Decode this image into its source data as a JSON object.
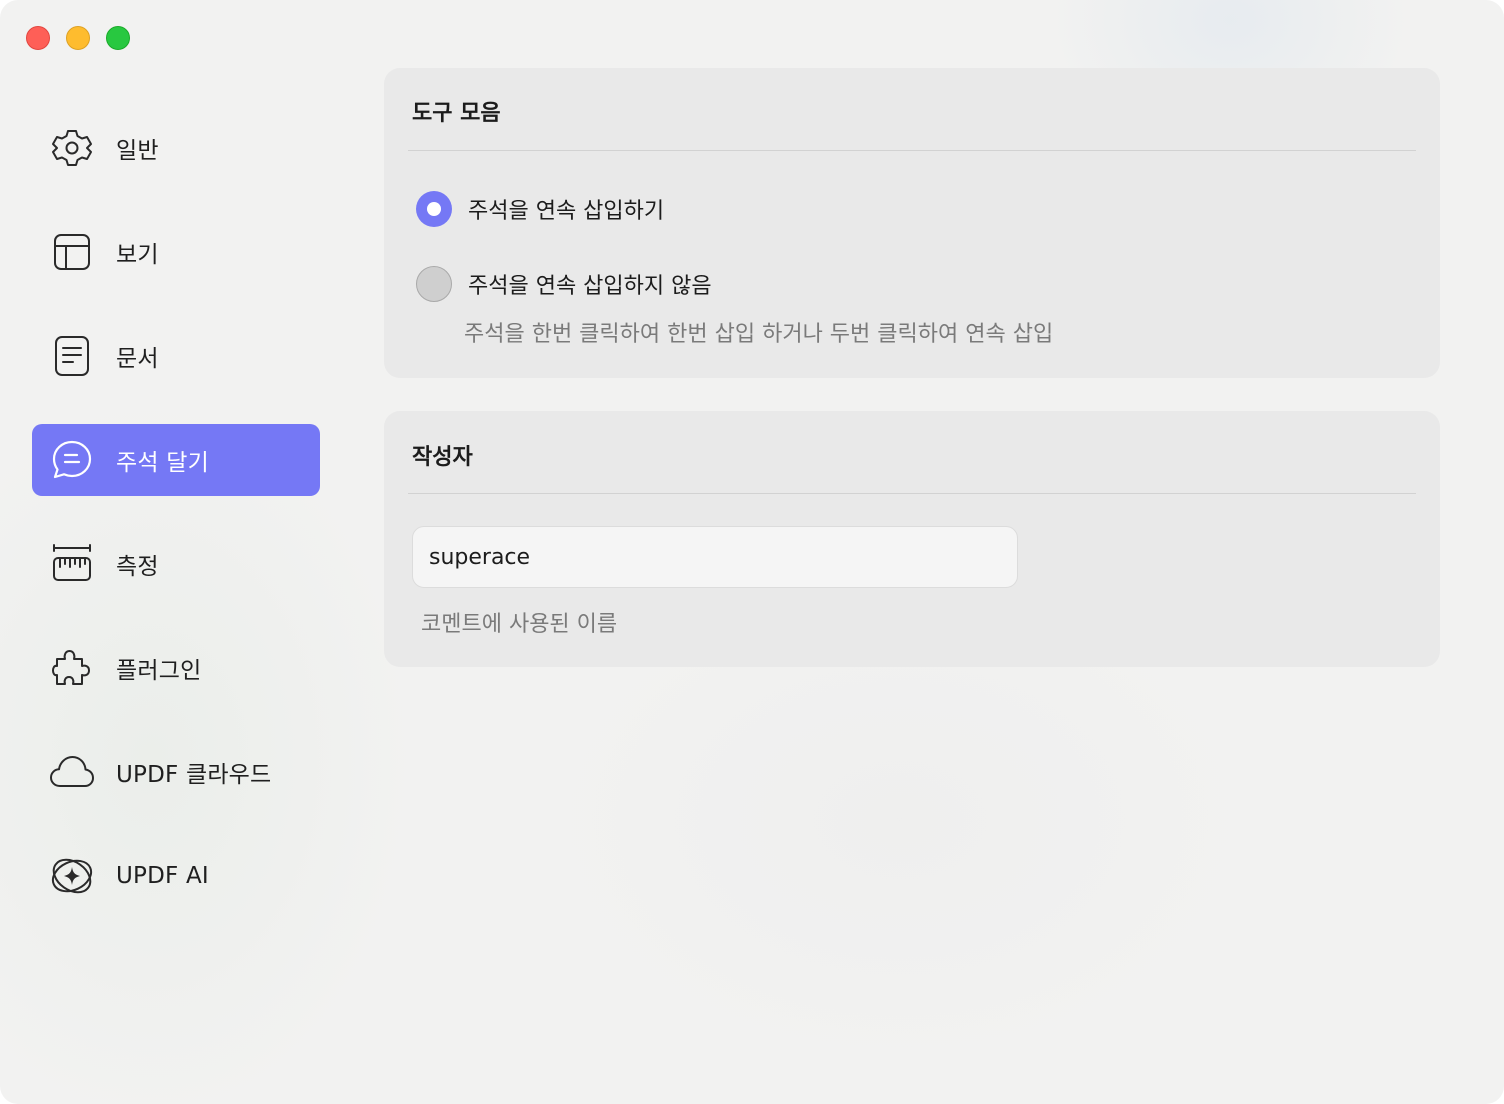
{
  "window": {
    "controls": [
      "close",
      "minimize",
      "maximize"
    ]
  },
  "sidebar": {
    "accent": "#7578f5",
    "items": [
      {
        "label": "일반",
        "icon": "gear-icon"
      },
      {
        "label": "보기",
        "icon": "layout-icon"
      },
      {
        "label": "문서",
        "icon": "document-icon"
      },
      {
        "label": "주석 달기",
        "icon": "comment-icon",
        "selected": true
      },
      {
        "label": "측정",
        "icon": "ruler-icon"
      },
      {
        "label": "플러그인",
        "icon": "puzzle-icon"
      },
      {
        "label": "UPDF 클라우드",
        "icon": "cloud-icon"
      },
      {
        "label": "UPDF AI",
        "icon": "ai-sparkle-icon"
      }
    ]
  },
  "toolbar_section": {
    "title": "도구 모음",
    "options": [
      {
        "label": "주석을 연속 삽입하기",
        "selected": true
      },
      {
        "label": "주석을 연속 삽입하지 않음",
        "selected": false
      }
    ],
    "helper": "주석을 한번 클릭하여 한번 삽입 하거나 두번 클릭하여 연속 삽입"
  },
  "author_section": {
    "title": "작성자",
    "author_value": "superace",
    "helper": "코멘트에 사용된 이름"
  }
}
